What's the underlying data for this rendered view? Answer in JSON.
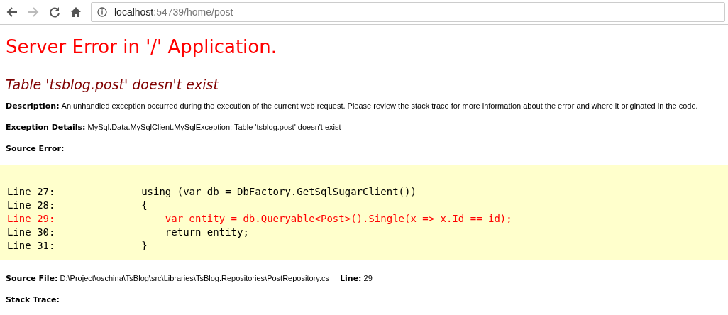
{
  "browser": {
    "back_disabled": false,
    "forward_disabled": true,
    "url_host": "localhost",
    "url_rest": ":54739/home/post"
  },
  "page": {
    "title": "Server Error in '/' Application.",
    "error_heading": "Table 'tsblog.post' doesn't exist",
    "description": {
      "label": "Description:",
      "text": "An unhandled exception occurred during the execution of the current web request. Please review the stack trace for more information about the error and where it originated in the code."
    },
    "exception_details": {
      "label": "Exception Details:",
      "text": "MySql.Data.MySqlClient.MySqlException: Table 'tsblog.post' doesn't exist"
    },
    "source_error_label": "Source Error:",
    "source_lines": [
      {
        "label": "Line 27:",
        "code": "            using (var db = DbFactory.GetSqlSugarClient())",
        "highlighted": false
      },
      {
        "label": "Line 28:",
        "code": "            {",
        "highlighted": false
      },
      {
        "label": "Line 29:",
        "code": "                var entity = db.Queryable<Post>().Single(x => x.Id == id);",
        "highlighted": true
      },
      {
        "label": "Line 30:",
        "code": "                return entity;",
        "highlighted": false
      },
      {
        "label": "Line 31:",
        "code": "            }",
        "highlighted": false
      }
    ],
    "source_file": {
      "label": "Source File:",
      "path": "D:\\Project\\oschina\\TsBlog\\src\\Libraries\\TsBlog.Repositories\\PostRepository.cs",
      "line_label": "Line:",
      "line": "29"
    },
    "stack_trace_label": "Stack Trace:"
  }
}
